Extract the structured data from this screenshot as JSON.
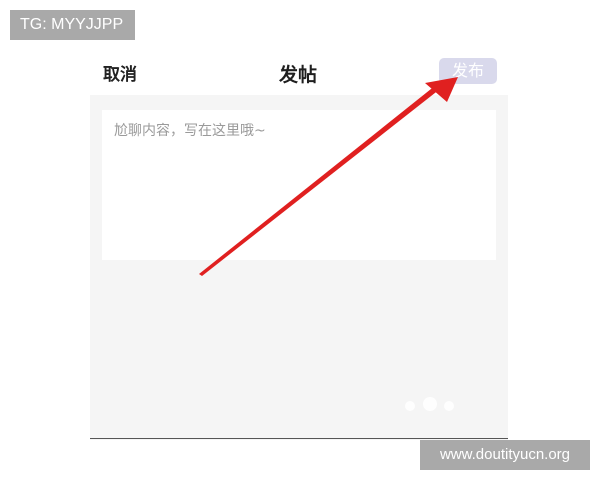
{
  "watermarks": {
    "top_left": "TG: MYYJJPP",
    "bottom_right": "www.doutityucn.org"
  },
  "header": {
    "cancel_label": "取消",
    "title": "发帖",
    "publish_label": "发布"
  },
  "editor": {
    "placeholder": "尬聊内容，写在这里哦~",
    "value": ""
  },
  "colors": {
    "publish_button_bg": "#d9d9ec",
    "arrow": "#e02020",
    "content_bg": "#f5f5f5"
  }
}
